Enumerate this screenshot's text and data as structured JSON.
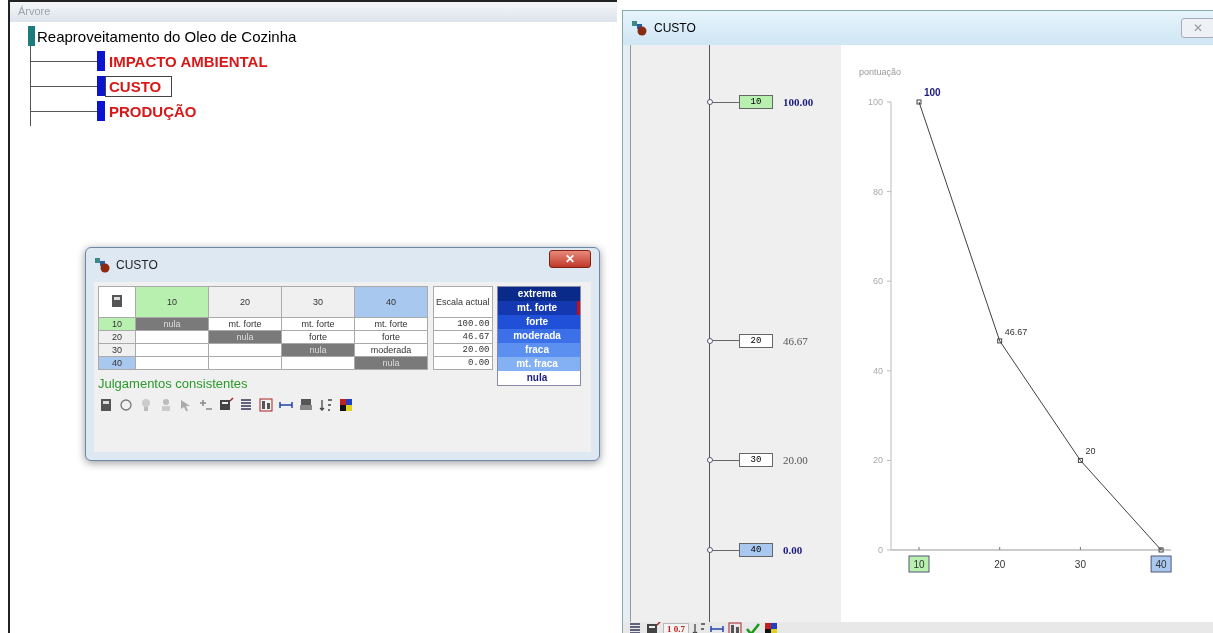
{
  "tree_panel": {
    "title": "Árvore",
    "root": {
      "label": "Reaproveitamento do Oleo de Cozinha",
      "expanded": true,
      "children": [
        {
          "label": "IMPACTO AMBIENTAL",
          "selected": false
        },
        {
          "label": "CUSTO",
          "selected": true
        },
        {
          "label": "PRODUÇÃO",
          "selected": false
        }
      ]
    }
  },
  "matrix_dialog": {
    "title": "CUSTO",
    "columns": [
      {
        "label": "10",
        "color": "#b8f0b0"
      },
      {
        "label": "20",
        "color": "#f0f0f0"
      },
      {
        "label": "30",
        "color": "#f0f0f0"
      },
      {
        "label": "40",
        "color": "#a8c8f0"
      }
    ],
    "scale_header": "Escala actual",
    "rows": [
      {
        "label": "10",
        "color": "#b8f0b0",
        "cells": [
          {
            "text": "nula",
            "kind": "diagonal"
          },
          {
            "text": "mt. forte",
            "kind": "value"
          },
          {
            "text": "mt. forte",
            "kind": "value"
          },
          {
            "text": "mt. forte",
            "kind": "value"
          }
        ],
        "scale": "100.00"
      },
      {
        "label": "20",
        "color": "#f0f0f0",
        "cells": [
          {
            "text": "",
            "kind": "empty"
          },
          {
            "text": "nula",
            "kind": "diagonal"
          },
          {
            "text": "forte",
            "kind": "value"
          },
          {
            "text": "forte",
            "kind": "value"
          }
        ],
        "scale": "46.67"
      },
      {
        "label": "30",
        "color": "#f0f0f0",
        "cells": [
          {
            "text": "",
            "kind": "empty"
          },
          {
            "text": "",
            "kind": "empty"
          },
          {
            "text": "nula",
            "kind": "diagonal"
          },
          {
            "text": "moderada",
            "kind": "value"
          }
        ],
        "scale": "20.00"
      },
      {
        "label": "40",
        "color": "#a8c8f0",
        "cells": [
          {
            "text": "",
            "kind": "empty"
          },
          {
            "text": "",
            "kind": "empty"
          },
          {
            "text": "",
            "kind": "empty"
          },
          {
            "text": "nula",
            "kind": "diagonal"
          }
        ],
        "scale": "0.00"
      }
    ],
    "legend": [
      {
        "label": "extrema",
        "color": "#0a2a8a",
        "selected": false
      },
      {
        "label": "mt. forte",
        "color": "#1438b0",
        "selected": true
      },
      {
        "label": "forte",
        "color": "#2050d8",
        "selected": false
      },
      {
        "label": "moderada",
        "color": "#3c70e8",
        "selected": false
      },
      {
        "label": "fraca",
        "color": "#5c90f0",
        "selected": false
      },
      {
        "label": "mt. fraca",
        "color": "#84b0f4",
        "selected": false
      },
      {
        "label": "nula",
        "color": "#ffffff",
        "selected": false
      }
    ],
    "status": "Julgamentos consistentes",
    "close_glyph": "✕"
  },
  "value_window": {
    "title": "CUSTO",
    "scale": [
      {
        "label": "10",
        "value": "100.00",
        "color": "#b8f0b0",
        "emphasis": true
      },
      {
        "label": "20",
        "value": "46.67",
        "color": "#ffffff",
        "emphasis": false
      },
      {
        "label": "30",
        "value": "20.00",
        "color": "#ffffff",
        "emphasis": false
      },
      {
        "label": "40",
        "value": "0.00",
        "color": "#a8c8f0",
        "emphasis": true
      }
    ],
    "close_glyph": "✕",
    "chart_data": {
      "type": "line",
      "ylabel": "pontuação",
      "categories": [
        "10",
        "20",
        "30",
        "40"
      ],
      "series": [
        {
          "color": "#404040",
          "marker": "square",
          "values": [
            100,
            46.67,
            20,
            0
          ]
        }
      ],
      "ylim": [
        0,
        100
      ],
      "yticks": [
        0,
        20,
        40,
        60,
        80,
        100
      ],
      "value_labels": [
        "100",
        "46.67",
        "20",
        null
      ]
    },
    "toolbar_text": "1 0.7"
  }
}
